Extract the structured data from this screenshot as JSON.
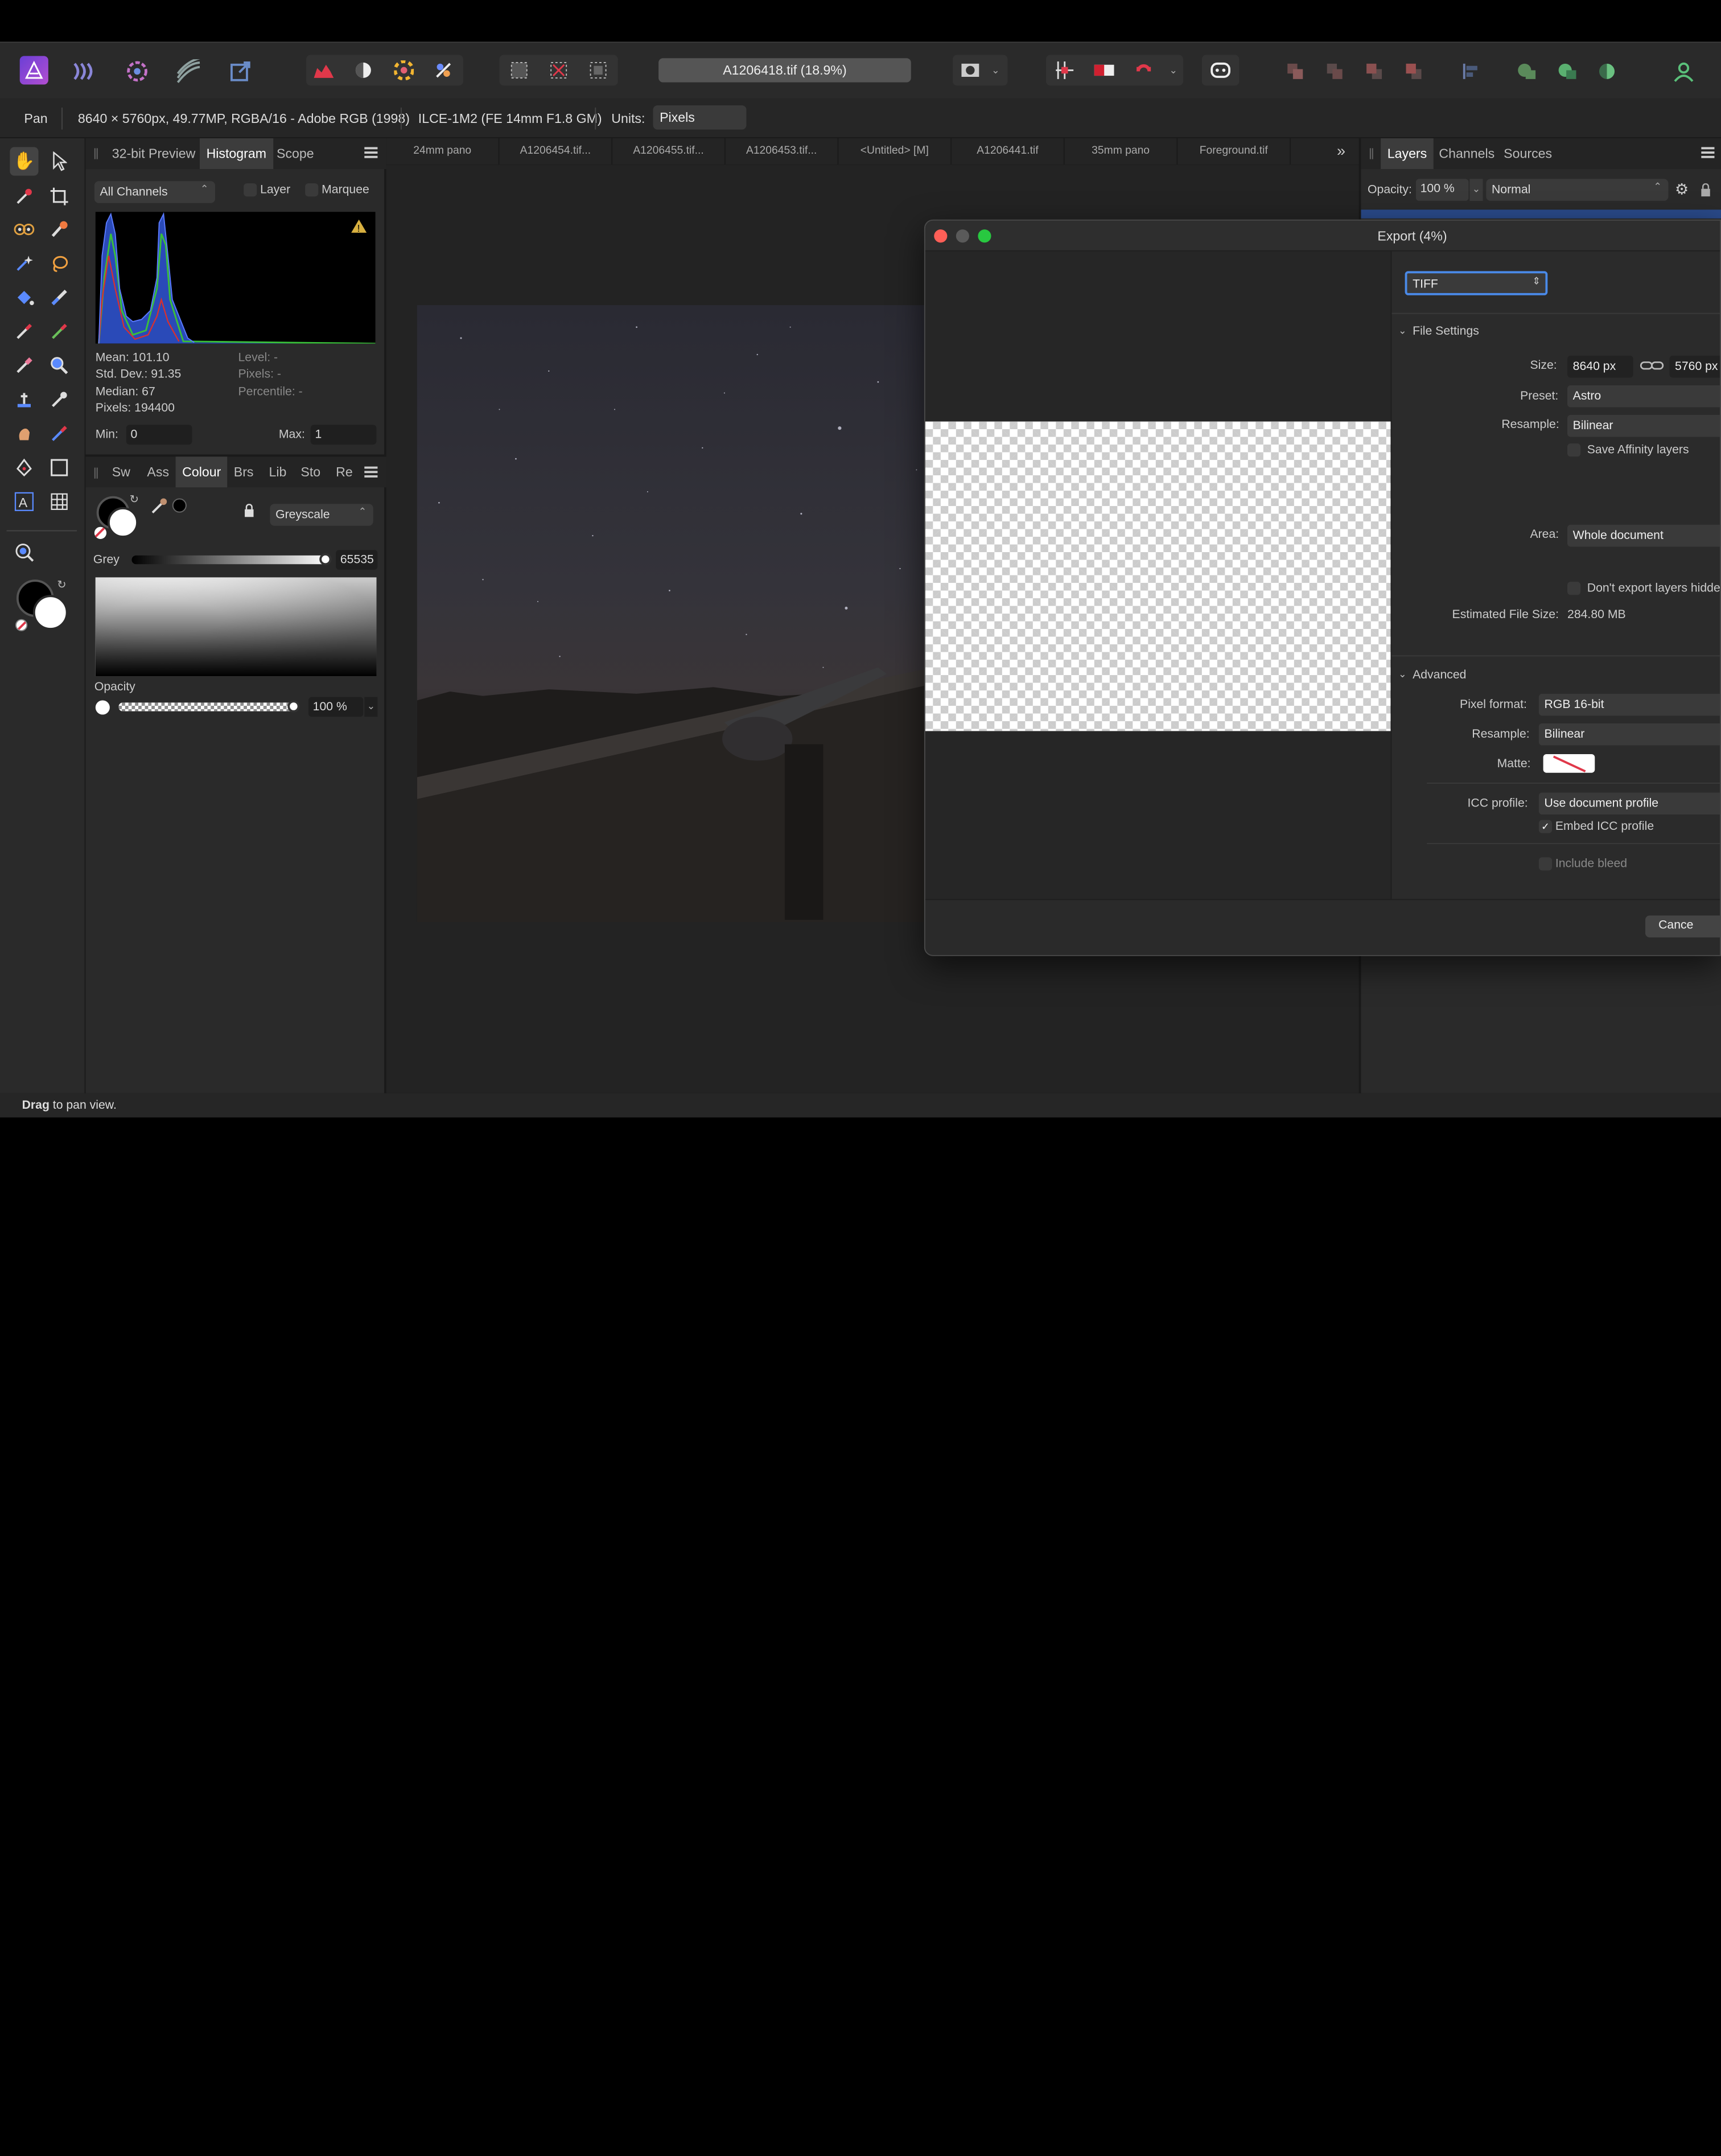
{
  "toolbar": {
    "doc_title": "A1206418.tif (18.9%)"
  },
  "context": {
    "tool_name": "Pan",
    "doc_info": "8640 × 5760px, 49.77MP, RGBA/16 - Adobe RGB (1998)",
    "camera_info": "ILCE-1M2 (FE 14mm F1.8 GM)",
    "units_label": "Units:",
    "units_value": "Pixels"
  },
  "histogram_panel": {
    "tabs": [
      "32-bit Preview",
      "Histogram",
      "Scope"
    ],
    "channels": "All Channels",
    "layer_label": "Layer",
    "marquee_label": "Marquee",
    "mean": "Mean: 101.10",
    "std_dev": "Std. Dev.: 91.35",
    "median": "Median: 67",
    "pixels": "Pixels: 194400",
    "level": "Level: -",
    "pixels_sel": "Pixels: -",
    "percentile": "Percentile: -",
    "min_label": "Min:",
    "min_value": "0",
    "max_label": "Max:",
    "max_value": "1"
  },
  "colour_panel": {
    "tabs": [
      "Sw",
      "Ass",
      "Colour",
      "Brs",
      "Lib",
      "Sto",
      "Re"
    ],
    "mode": "Greyscale",
    "grey_label": "Grey",
    "grey_value": "65535",
    "opacity_label": "Opacity",
    "opacity_value": "100 %"
  },
  "doc_tabs": [
    "24mm pano",
    "A1206454.tif...",
    "A1206455.tif...",
    "A1206453.tif...",
    "<Untitled> [M]",
    "A1206441.tif",
    "35mm pano",
    "Foreground.tif"
  ],
  "layers_panel": {
    "tabs": [
      "Layers",
      "Channels",
      "Sources"
    ],
    "opacity_label": "Opacity:",
    "opacity_value": "100 %",
    "blend_mode": "Normal"
  },
  "export_dialog": {
    "title": "Export (4%)",
    "format": "TIFF",
    "file_settings_label": "File Settings",
    "size_label": "Size:",
    "width": "8640 px",
    "height": "5760 px",
    "preset_label": "Preset:",
    "preset": "Astro",
    "resample_label": "Resample:",
    "resample": "Bilinear",
    "save_affinity_layers": "Save Affinity layers",
    "area_label": "Area:",
    "area": "Whole document",
    "dont_export_hidden": "Don't export layers hidde",
    "est_size_label": "Estimated File Size:",
    "est_size": "284.80 MB",
    "advanced_label": "Advanced",
    "pixel_format_label": "Pixel format:",
    "pixel_format": "RGB 16-bit",
    "adv_resample_label": "Resample:",
    "adv_resample": "Bilinear",
    "matte_label": "Matte:",
    "icc_label": "ICC profile:",
    "icc": "Use document profile",
    "embed_icc": "Embed ICC profile",
    "include_bleed": "Include bleed",
    "cancel": "Cance"
  },
  "status": {
    "bold": "Drag",
    "text": " to pan view."
  },
  "colors": {
    "accent": "#4a8ae8",
    "close": "#ff5f57",
    "minimize": "#5a5a5a",
    "zoom": "#28c840",
    "affinity": "#8c4ad8"
  }
}
